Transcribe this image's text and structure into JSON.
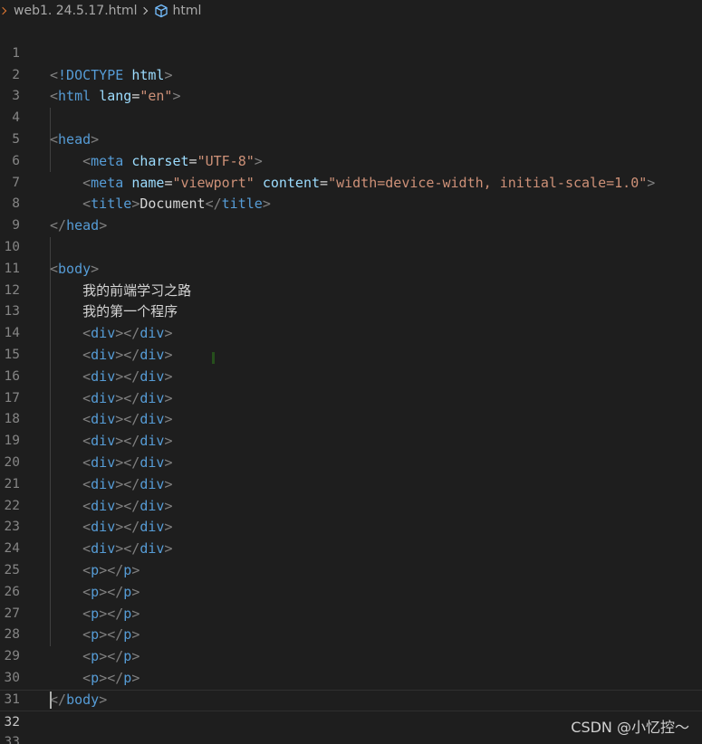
{
  "breadcrumb": {
    "file": "web1. 24.5.17.html",
    "symbol": "html",
    "chevron_icon": "chevron-right-icon",
    "symbol_icon": "html-element-cube-icon"
  },
  "editor": {
    "current_line": 32,
    "lines": [
      {
        "n": "1"
      },
      {
        "n": "2"
      },
      {
        "n": "3"
      },
      {
        "n": "4"
      },
      {
        "n": "5"
      },
      {
        "n": "6"
      },
      {
        "n": "7"
      },
      {
        "n": "8"
      },
      {
        "n": "9"
      },
      {
        "n": "10"
      },
      {
        "n": "11"
      },
      {
        "n": "12"
      },
      {
        "n": "13"
      },
      {
        "n": "14"
      },
      {
        "n": "15"
      },
      {
        "n": "16"
      },
      {
        "n": "17"
      },
      {
        "n": "18"
      },
      {
        "n": "19"
      },
      {
        "n": "20"
      },
      {
        "n": "21"
      },
      {
        "n": "22"
      },
      {
        "n": "23"
      },
      {
        "n": "24"
      },
      {
        "n": "25"
      },
      {
        "n": "26"
      },
      {
        "n": "27"
      },
      {
        "n": "28"
      },
      {
        "n": "29"
      },
      {
        "n": "30"
      },
      {
        "n": "31"
      },
      {
        "n": "32"
      },
      {
        "n": "33"
      }
    ],
    "tokens": {
      "lt": "<",
      "gt": ">",
      "lt_slash": "</",
      "doctype": "!DOCTYPE",
      "html": "html",
      "head": "head",
      "meta": "meta",
      "title": "title",
      "body": "body",
      "div": "div",
      "p": "p",
      "lang": "lang",
      "charset": "charset",
      "name": "name",
      "content": "content",
      "eq": "=",
      "v_en": "\"en\"",
      "v_utf8": "\"UTF-8\"",
      "v_viewport": "\"viewport\"",
      "v_content": "\"width=device-width, initial-scale=1.0\"",
      "document": "Document",
      "text1": "我的前端学习之路",
      "text2": "我的第一个程序"
    }
  },
  "watermark": "CSDN @小忆控～",
  "colors": {
    "background": "#1e1e1e",
    "tag": "#569cd6",
    "bracket": "#808080",
    "attribute": "#9cdcfe",
    "string": "#ce9178",
    "text": "#d4d4d4",
    "line_number": "#858585"
  }
}
